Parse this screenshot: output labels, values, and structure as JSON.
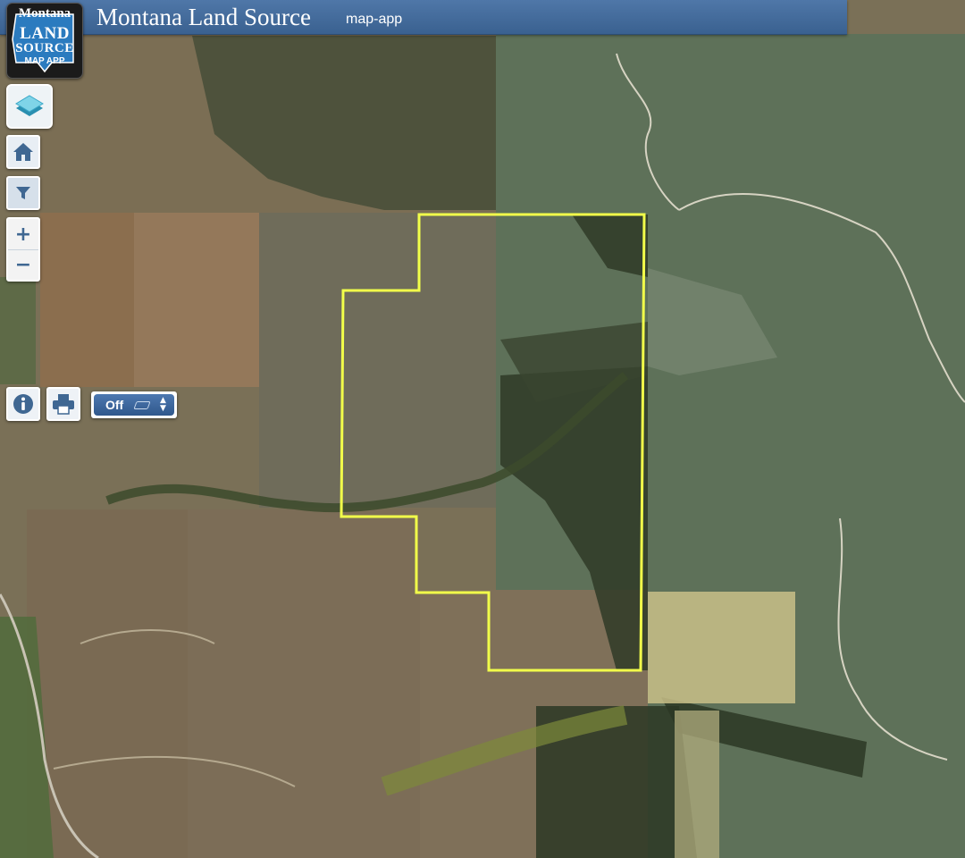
{
  "header": {
    "title": "Montana Land Source",
    "subtitle": "map-app"
  },
  "logo": {
    "line1": "Montana",
    "line2": "LAND",
    "line3": "SOURCE",
    "line4": "MAP APP"
  },
  "toolbar": {
    "layers_icon": "layers-icon",
    "home_icon": "home-icon",
    "filter_icon": "filter-icon",
    "zoom_in_label": "+",
    "zoom_out_label": "−",
    "info_icon": "info-icon",
    "print_icon": "print-icon"
  },
  "overlay_select": {
    "selected": "Off",
    "arrows_up": "▲",
    "arrows_down": "▼"
  },
  "colors": {
    "header_bg": "#4a72a3",
    "boundary": "#f2ff4a",
    "button_blue": "#3f6792"
  }
}
